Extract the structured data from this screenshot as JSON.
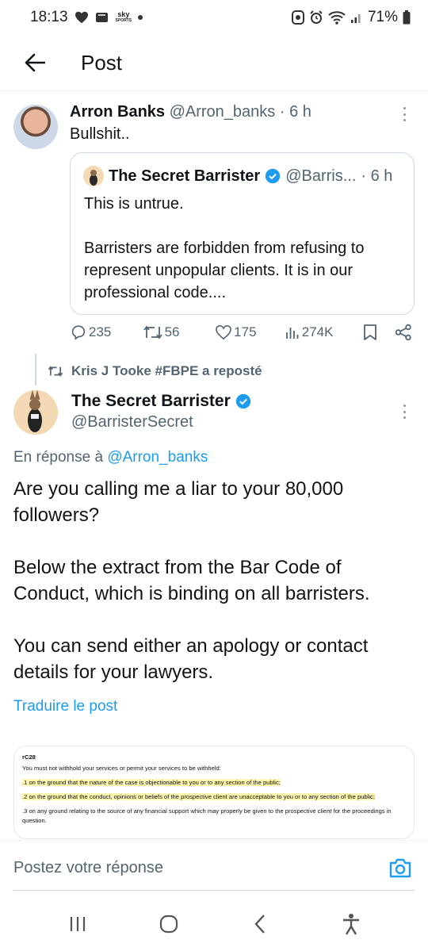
{
  "status_bar": {
    "time": "18:13",
    "sky_label_top": "sky",
    "sky_label_bottom": "SPORTS",
    "battery": "71%"
  },
  "header": {
    "title": "Post"
  },
  "tweet1": {
    "name": "Arron Banks",
    "handle": "@Arron_banks",
    "separator": " · ",
    "time": "6 h",
    "text": "Bullshit..",
    "quote": {
      "name": "The Secret Barrister",
      "handle": "@Barris...",
      "time": "· 6 h",
      "text": "This is untrue.\n\nBarristers are forbidden from refusing to represent unpopular clients. It is in our professional code...."
    },
    "actions": {
      "replies": "235",
      "reposts": "56",
      "likes": "175",
      "views": "274K"
    }
  },
  "repost": {
    "label": "Kris J Tooke #FBPE a reposté"
  },
  "tweet2": {
    "name": "The Secret Barrister",
    "handle": "@BarristerSecret",
    "reply_prefix": "En réponse à ",
    "reply_handle": "@Arron_banks",
    "text": "Are you calling me a liar to your 80,000 followers?\n\nBelow the extract from the Bar Code of Conduct, which is binding on all barristers.\n\nYou can send either an apology or contact details for your lawyers.",
    "translate": "Traduire le post",
    "attachment": {
      "title": "rC28",
      "intro": "You must not withhold your services or permit your services to be withheld:",
      "item1": ".1 on the ground that the nature of the case is objectionable to you or to any section of the public;",
      "item2": ".2 on the ground that the conduct, opinions or beliefs of the prospective client are unacceptable to you or to any section of the public;",
      "item3a": ".3 on any ground relating to the source of any financial support which may properly be given to the prospective ",
      "item3_client": "client",
      "item3b": " for the proceedings in question."
    }
  },
  "reply_box": {
    "placeholder": "Postez votre réponse"
  },
  "colors": {
    "accent": "#1d9bf0",
    "muted": "#536471",
    "highlight": "#fdf6b0"
  }
}
